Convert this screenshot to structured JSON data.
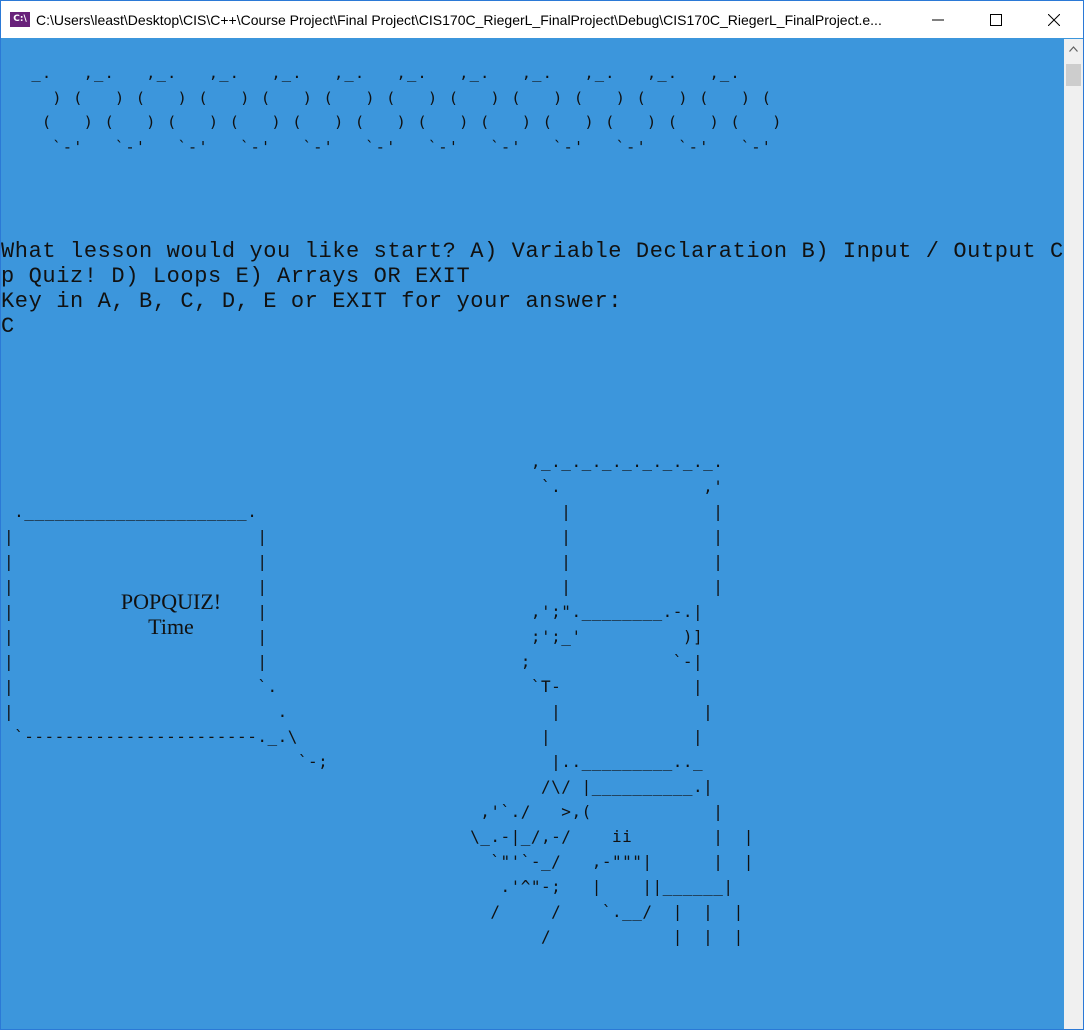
{
  "window": {
    "title": "C:\\Users\\least\\Desktop\\CIS\\C++\\Course Project\\Final Project\\CIS170C_RiegerL_FinalProject\\Debug\\CIS170C_RiegerL_FinalProject.e...",
    "app_icon_label": "C:\\",
    "controls": {
      "minimize": "minimize-icon",
      "maximize": "maximize-icon",
      "close": "close-icon"
    }
  },
  "console": {
    "banner_art": " _.   ,_.   ,_.   ,_.   ,_.   ,_.   ,_.   ,_.   ,_.   ,_.   ,_.   ,_.\n   ) (   ) (   ) (   ) (   ) (   ) (   ) (   ) (   ) (   ) (   ) (   ) (\n  (   ) (   ) (   ) (   ) (   ) (   ) (   ) (   ) (   ) (   ) (   ) (   )\n   `-'   `-'   `-'   `-'   `-'   `-'   `-'   `-'   `-'   `-'   `-'   `-'",
    "lesson_prompt_line1": "What lesson would you like start? A) Variable Declaration B) Input / Output C) Po",
    "lesson_prompt_line2": "p Quiz! D) Loops E) Arrays OR EXIT",
    "key_prompt": "Key in A, B, C, D, E or EXIT for your answer:",
    "user_answer": "C",
    "popquiz_line1": "POPQUIZ!",
    "popquiz_line2": "Time",
    "quiz_art": "                                                    ,_._._._._._._._._.\n                                                     `.              ,'\n .______________________.                              |              |\n|                        |                             |              |\n|                        |                             |              |\n|                        |                             |              |\n|                        |                          ,';\".________.-.|\n|                        |                          ;';_'          )]\n|                        |                         ;              `-|\n|                        `.                         `T-             |\n|                          .                          |              |\n `-----------------------._.\\                        |              |\n                             `-;                      |.._________.._\n                                                     /\\/ |__________.|\n                                               ,'`./   >,(            |\n                                              \\_.-|_/,-/    ii        |  |\n                                                `\"'`-_/   ,-\"\"\"|      |  |\n                                                 .'^\"-;   |    ||______|\n                                                /     /    `.__/  |  |  |\n                                                     /            |  |  |"
  },
  "scrollbar": {
    "up_icon": "scroll-up-arrow-icon"
  }
}
